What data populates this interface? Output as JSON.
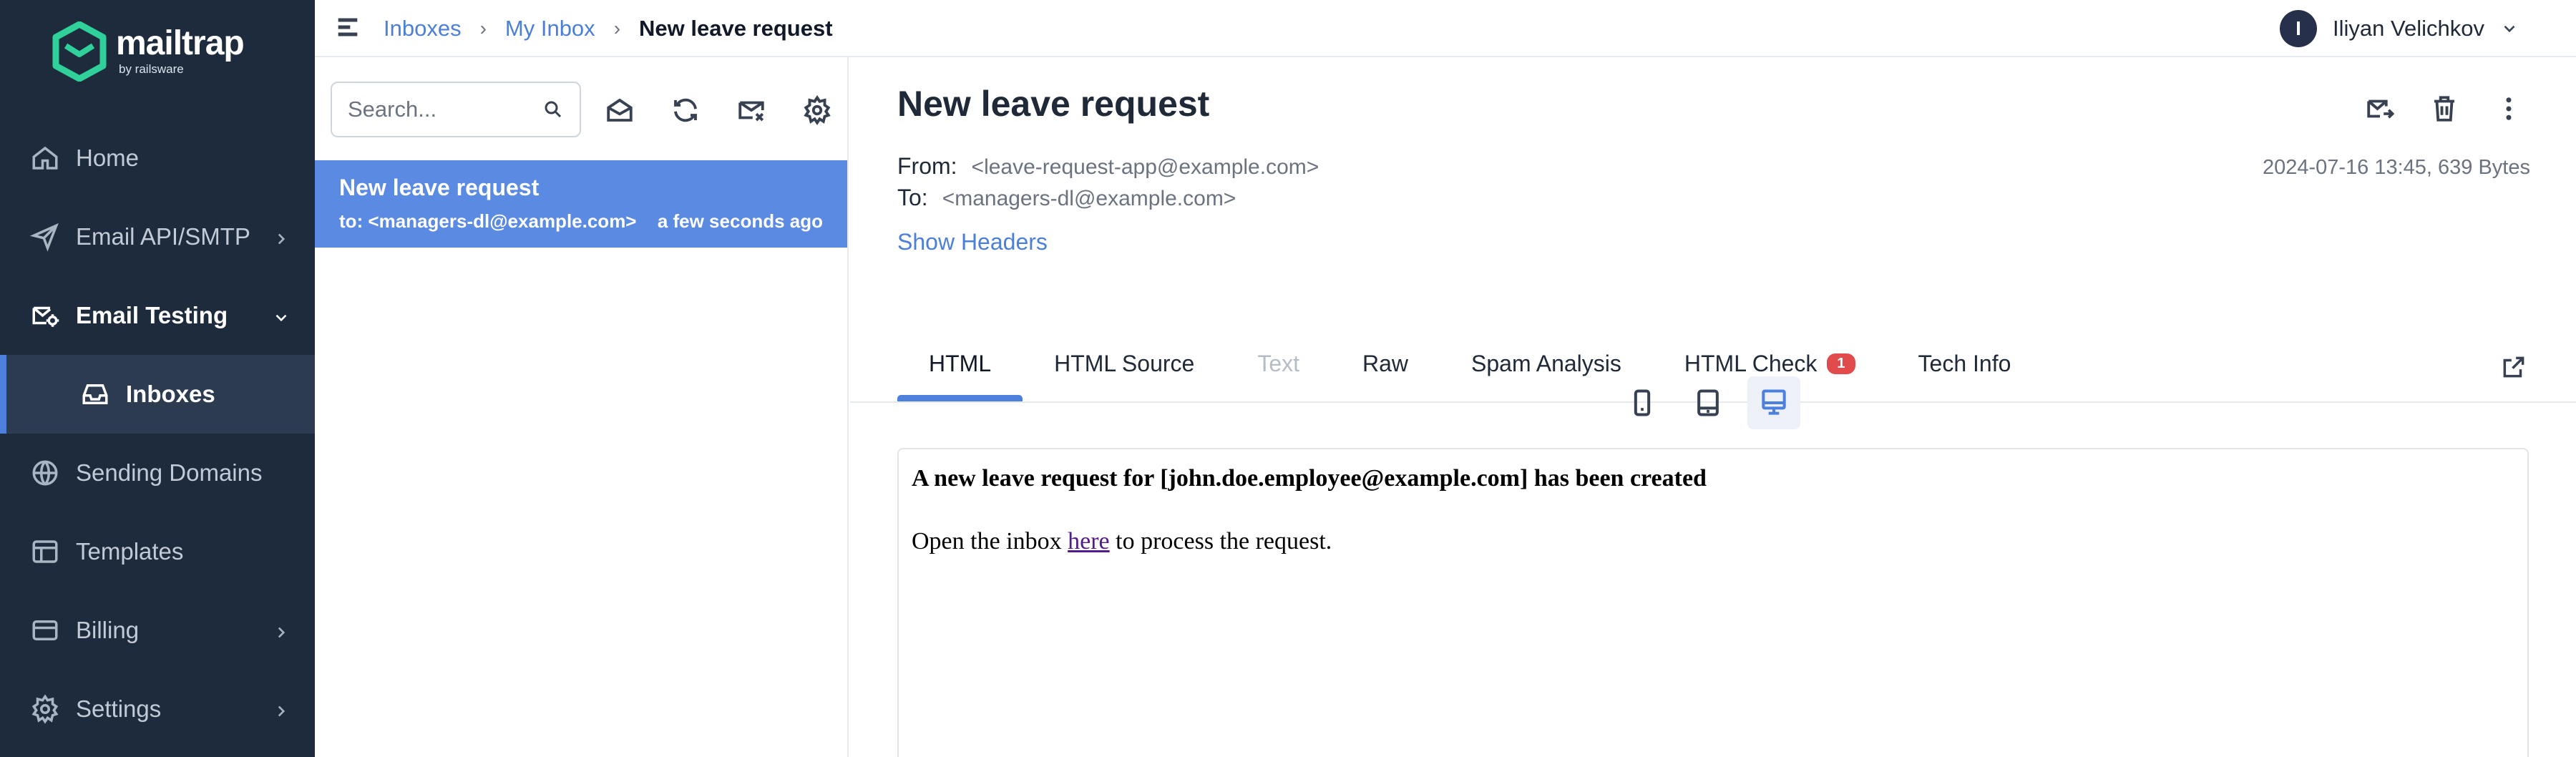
{
  "brand": {
    "name": "mailtrap",
    "tagline": "by railsware"
  },
  "sidebar": {
    "items": [
      {
        "label": "Home",
        "icon": "home-icon"
      },
      {
        "label": "Email API/SMTP",
        "icon": "send-icon"
      },
      {
        "label": "Email Testing",
        "icon": "email-testing-icon"
      },
      {
        "label": "Inboxes",
        "icon": "inbox-icon"
      },
      {
        "label": "Sending Domains",
        "icon": "globe-icon"
      },
      {
        "label": "Templates",
        "icon": "template-icon"
      },
      {
        "label": "Billing",
        "icon": "billing-icon"
      },
      {
        "label": "Settings",
        "icon": "gear-icon"
      }
    ]
  },
  "topbar": {
    "breadcrumbs": [
      "Inboxes",
      "My Inbox",
      "New leave request"
    ],
    "user": {
      "initial": "I",
      "name": "Iliyan Velichkov"
    }
  },
  "list": {
    "search_placeholder": "Search...",
    "messages": [
      {
        "subject": "New leave request",
        "to": "to: <managers-dl@example.com>",
        "time": "a few seconds ago"
      }
    ]
  },
  "message": {
    "subject": "New leave request",
    "from_label": "From:",
    "from": "<leave-request-app@example.com>",
    "to_label": "To:",
    "to": "<managers-dl@example.com>",
    "date_size": "2024-07-16 13:45, 639 Bytes",
    "show_headers": "Show Headers",
    "tabs": [
      {
        "label": "HTML",
        "state": "active"
      },
      {
        "label": "HTML Source",
        "state": "normal"
      },
      {
        "label": "Text",
        "state": "disabled"
      },
      {
        "label": "Raw",
        "state": "normal"
      },
      {
        "label": "Spam Analysis",
        "state": "normal"
      },
      {
        "label": "HTML Check",
        "state": "normal",
        "badge": "1"
      },
      {
        "label": "Tech Info",
        "state": "normal"
      }
    ],
    "preview": {
      "heading": "A new leave request for [john.doe.employee@example.com] has been created",
      "body_before": "Open the inbox ",
      "link": "here",
      "body_after": " to process the request."
    }
  },
  "colors": {
    "sidebar_bg": "#1e2b3c",
    "accent": "#4d7fdc",
    "selected_message": "#5a8ae2",
    "badge": "#e24b4b"
  }
}
